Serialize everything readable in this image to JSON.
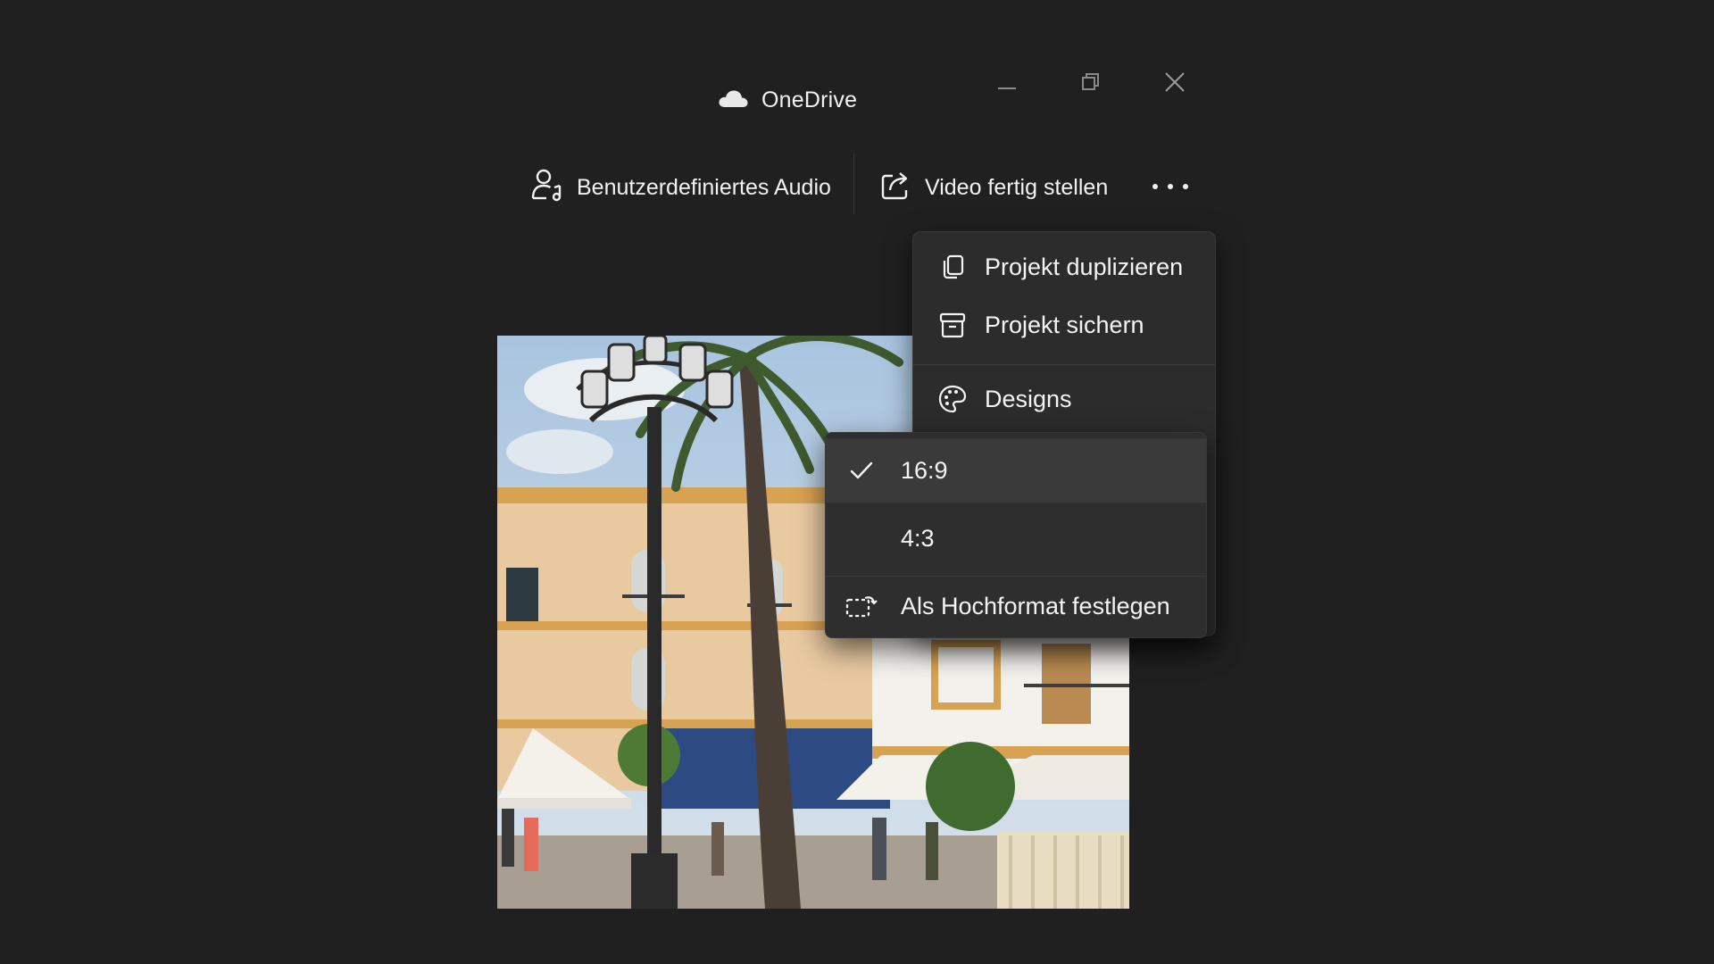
{
  "app": {
    "title": "OneDrive"
  },
  "window_controls": {
    "minimize": "minimize-icon",
    "restore": "restore-icon",
    "close": "close-icon"
  },
  "toolbar": {
    "custom_audio_label": "Benutzerdefiniertes Audio",
    "finish_video_label": "Video fertig stellen",
    "more_icon": "more-dots-icon"
  },
  "more_menu": {
    "items": [
      {
        "label": "Projekt duplizieren",
        "icon": "duplicate-icon"
      },
      {
        "label": "Projekt sichern",
        "icon": "archive-icon"
      },
      {
        "label": "Designs",
        "icon": "palette-icon"
      }
    ]
  },
  "aspect_submenu": {
    "items": [
      {
        "label": "16:9",
        "selected": true,
        "icon": "checkmark-icon"
      },
      {
        "label": "4:3",
        "selected": false
      },
      {
        "label": "Als Hochformat festlegen",
        "icon": "rotate-portrait-icon"
      }
    ]
  },
  "colors": {
    "background": "#202020",
    "menu_background": "#2c2c2c",
    "selected_background": "#3a3a3a",
    "text": "#f4f4f4"
  }
}
